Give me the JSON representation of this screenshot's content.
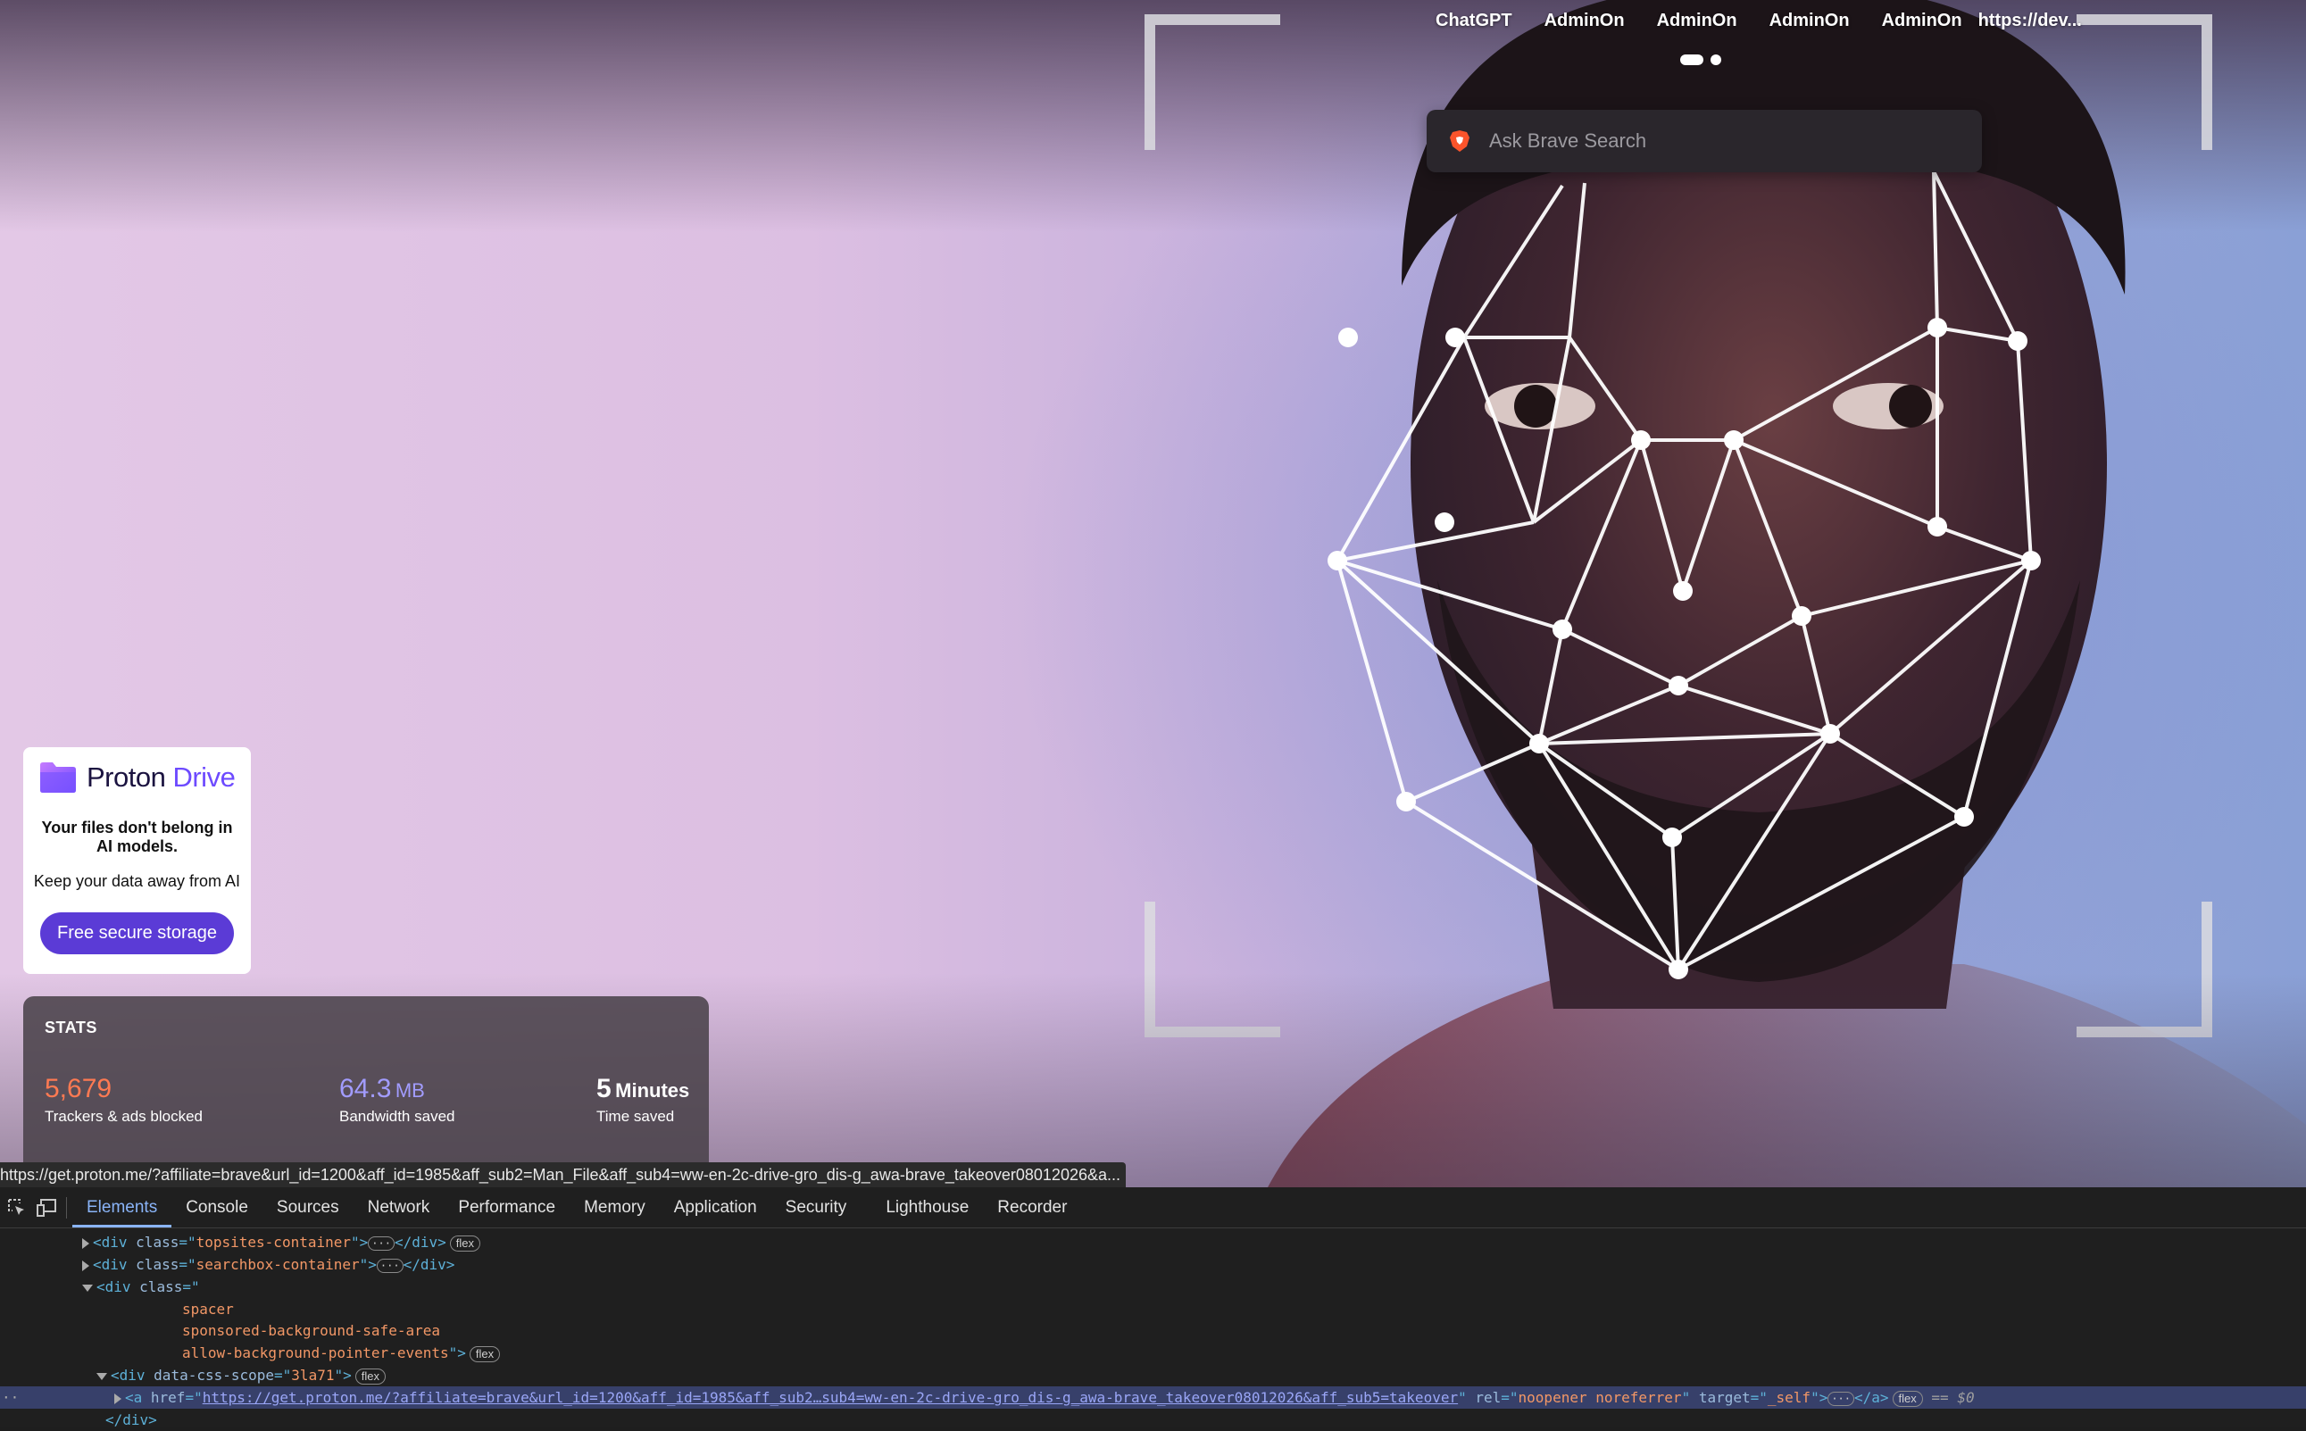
{
  "newtab": {
    "topsites": [
      "ChatGPT",
      "AdminOn",
      "AdminOn",
      "AdminOn",
      "AdminOn",
      "https://dev..."
    ],
    "search": {
      "placeholder": "Ask Brave Search"
    },
    "sponsored": {
      "brand_name": "Proton",
      "brand_product": "Drive",
      "headline": "Your files don't belong in AI models.",
      "subtext": "Keep your data away from AI",
      "cta": "Free secure storage"
    },
    "stats": {
      "title": "STATS",
      "trackers": {
        "value": "5,679",
        "label": "Trackers & ads blocked"
      },
      "bandwidth": {
        "value": "64.3",
        "unit": "MB",
        "label": "Bandwidth saved"
      },
      "time": {
        "value": "5",
        "unit": "Minutes",
        "label": "Time saved"
      }
    },
    "status_url": "https://get.proton.me/?affiliate=brave&url_id=1200&aff_id=1985&aff_sub2=Man_File&aff_sub4=ww-en-2c-drive-gro_dis-g_awa-brave_takeover08012026&a..."
  },
  "devtools": {
    "tabs": [
      "Elements",
      "Console",
      "Sources",
      "Network",
      "Performance",
      "Memory",
      "Application",
      "Security",
      "Lighthouse",
      "Recorder"
    ],
    "active_tab": "Elements",
    "dom": {
      "topsites_class": "topsites-container",
      "searchbox_class": "searchbox-container",
      "spacer_classes": [
        "spacer",
        "sponsored-background-safe-area",
        "allow-background-pointer-events"
      ],
      "scope_value": "3la71",
      "anchor_href": "https://get.proton.me/?affiliate=brave&url_id=1200&aff_id=1985&aff_sub2…sub4=ww-en-2c-drive-gro_dis-g_awa-brave_takeover08012026&aff_sub5=takeover",
      "anchor_rel": "noopener noreferrer",
      "anchor_target": "_self",
      "badge_flex": "flex",
      "selected_ref": "== $0",
      "close_div": "</div>"
    }
  },
  "colors": {
    "trackers": "#ff7a52",
    "bandwidth": "#a29cff",
    "devtools_accent": "#8ab4f8",
    "cta": "#5b3bd6"
  }
}
